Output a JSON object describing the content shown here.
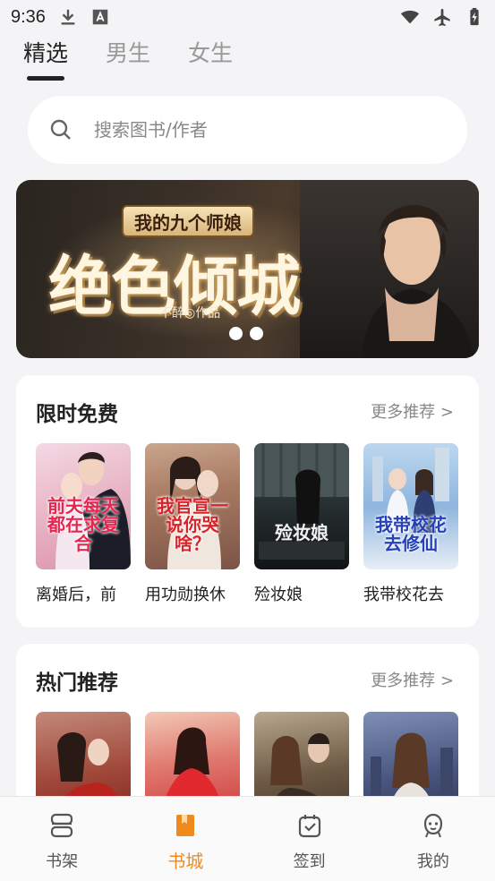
{
  "status_bar": {
    "time": "9:36",
    "left_icons": [
      "download-icon",
      "font-a-icon"
    ],
    "right_icons": [
      "wifi-icon",
      "airplane-icon",
      "battery-charging-icon"
    ]
  },
  "top_tabs": [
    {
      "label": "精选",
      "active": true
    },
    {
      "label": "男生",
      "active": false
    },
    {
      "label": "女生",
      "active": false
    }
  ],
  "search": {
    "placeholder": "搜索图书/作者",
    "icon": "search-icon"
  },
  "banner": {
    "subtitle": "我的九个师娘",
    "title": "绝色倾城",
    "author": "不醉◎作品",
    "page_count": 2
  },
  "free_section": {
    "title": "限时免费",
    "more": "更多推荐 >",
    "books": [
      {
        "title": "离婚后，前",
        "cover_text": "前夫每天都在求复合"
      },
      {
        "title": "用功勋换休",
        "cover_text": "我官宣一说你哭啥？"
      },
      {
        "title": "殓妆娘",
        "cover_text": "殓妆娘"
      },
      {
        "title": "我带校花去",
        "cover_text": "我带校花去修仙"
      }
    ]
  },
  "hot_section": {
    "title": "热门推荐",
    "more": "更多推荐 >"
  },
  "bottom_nav": [
    {
      "label": "书架",
      "icon": "bookshelf-icon",
      "active": false
    },
    {
      "label": "书城",
      "icon": "bookstore-icon",
      "active": true
    },
    {
      "label": "签到",
      "icon": "checkin-icon",
      "active": false
    },
    {
      "label": "我的",
      "icon": "profile-icon",
      "active": false
    }
  ],
  "colors": {
    "accent": "#f08a1c",
    "background": "#f4f4f6",
    "text_primary": "#222222",
    "text_secondary": "#888888"
  }
}
